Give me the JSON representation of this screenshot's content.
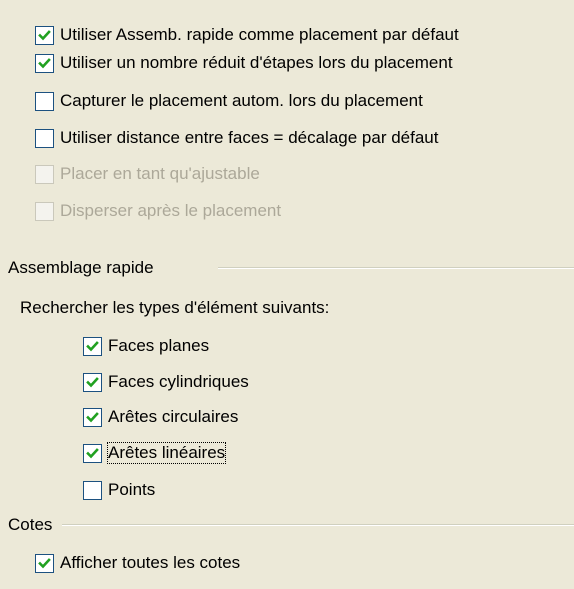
{
  "options": [
    {
      "label": "Utiliser Assemb. rapide comme placement par défaut",
      "checked": true,
      "disabled": false
    },
    {
      "label": "Utiliser un nombre réduit d'étapes lors du placement",
      "checked": true,
      "disabled": false
    },
    {
      "label": "Capturer le placement autom. lors du placement",
      "checked": false,
      "disabled": false
    },
    {
      "label": "Utiliser distance entre faces = décalage par défaut",
      "checked": false,
      "disabled": false
    },
    {
      "label": "Placer en tant qu'ajustable",
      "checked": false,
      "disabled": true
    },
    {
      "label": "Disperser après le placement",
      "checked": false,
      "disabled": true
    }
  ],
  "assemblage": {
    "title": "Assemblage rapide",
    "search_label": "Rechercher les types d'élément suivants:",
    "items": [
      {
        "label": "Faces planes",
        "checked": true
      },
      {
        "label": "Faces cylindriques",
        "checked": true
      },
      {
        "label": "Arêtes circulaires",
        "checked": true
      },
      {
        "label": "Arêtes linéaires",
        "checked": true,
        "focused": true
      },
      {
        "label": "Points",
        "checked": false
      }
    ]
  },
  "cotes": {
    "title": "Cotes",
    "items": [
      {
        "label": "Afficher toutes les cotes",
        "checked": true
      }
    ]
  },
  "colors": {
    "check": "#21a121",
    "checkbox_border": "#1c5180",
    "disabled_text": "#aca899",
    "background": "#ece9d8"
  }
}
